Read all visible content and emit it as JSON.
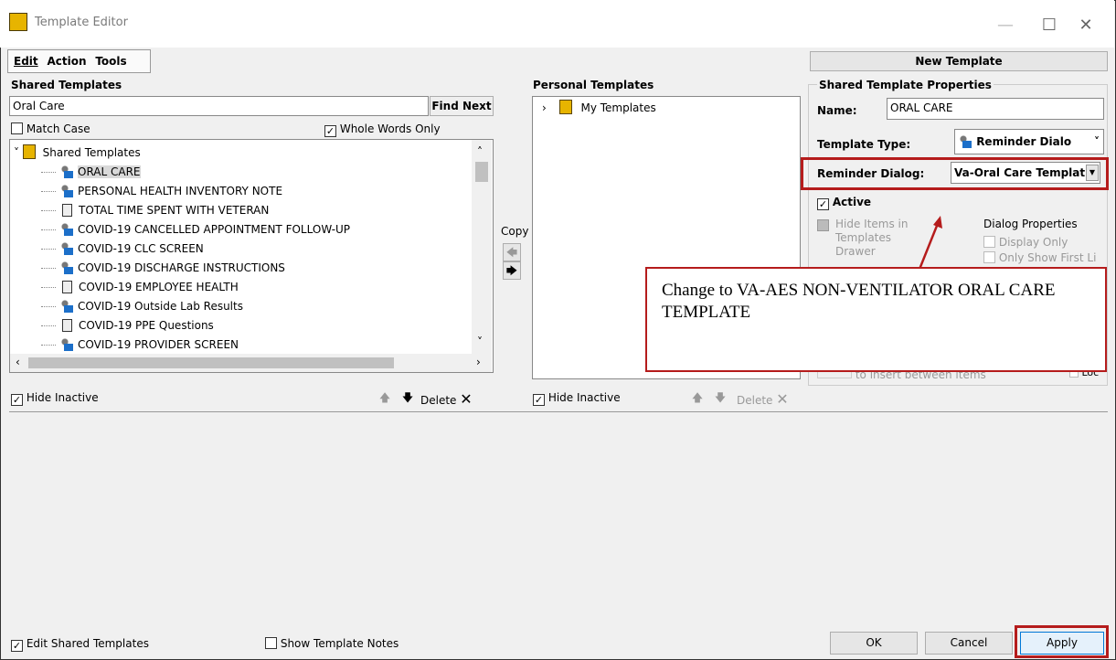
{
  "window": {
    "title": "Template Editor",
    "minimize": "—",
    "maximize": "☐",
    "close": "✕"
  },
  "menu": {
    "edit": "Edit",
    "action": "Action",
    "tools": "Tools"
  },
  "new_template_button": "New Template",
  "shared": {
    "heading": "Shared Templates",
    "search_value": "Oral Care",
    "find_next": "Find Next",
    "match_case": "Match Case",
    "whole_words": "Whole Words Only",
    "tree_root": "Shared Templates",
    "items": [
      {
        "label": "ORAL CARE",
        "icon": "reminder-dialog-icon"
      },
      {
        "label": "PERSONAL HEALTH INVENTORY NOTE",
        "icon": "reminder-dialog-icon"
      },
      {
        "label": "TOTAL TIME SPENT WITH VETERAN",
        "icon": "document-icon"
      },
      {
        "label": "COVID-19 CANCELLED APPOINTMENT FOLLOW-UP",
        "icon": "reminder-dialog-icon"
      },
      {
        "label": "COVID-19 CLC SCREEN",
        "icon": "reminder-dialog-icon"
      },
      {
        "label": "COVID-19 DISCHARGE INSTRUCTIONS",
        "icon": "reminder-dialog-icon"
      },
      {
        "label": "COVID-19 EMPLOYEE HEALTH",
        "icon": "document-icon"
      },
      {
        "label": "COVID-19 Outside Lab Results",
        "icon": "reminder-dialog-icon"
      },
      {
        "label": "COVID-19 PPE Questions",
        "icon": "document-icon"
      },
      {
        "label": "COVID-19 PROVIDER SCREEN",
        "icon": "reminder-dialog-icon"
      }
    ],
    "hide_inactive": "Hide Inactive",
    "delete": "Delete"
  },
  "copy_label": "Copy",
  "personal": {
    "heading": "Personal Templates",
    "tree_root": "My Templates",
    "hide_inactive": "Hide Inactive",
    "delete": "Delete"
  },
  "props": {
    "group_title": "Shared Template Properties",
    "name_label": "Name:",
    "name_value": "ORAL CARE",
    "type_label": "Template Type:",
    "type_value": "Reminder Dialo",
    "reminder_label": "Reminder Dialog:",
    "reminder_value": "Va-Oral Care Templat",
    "active": "Active",
    "hide_items": "Hide Items in Templates Drawer",
    "dialog_props": "Dialog Properties",
    "display_only": "Display Only",
    "only_show_first": "Only Show First Li",
    "insert_between": "to insert between items",
    "loc": "Loc"
  },
  "annotation": {
    "text": "Change to VA-AES NON-VENTILATOR ORAL CARE TEMPLATE"
  },
  "bottom": {
    "edit_shared": "Edit Shared Templates",
    "show_notes": "Show Template Notes",
    "ok": "OK",
    "cancel": "Cancel",
    "apply": "Apply"
  }
}
